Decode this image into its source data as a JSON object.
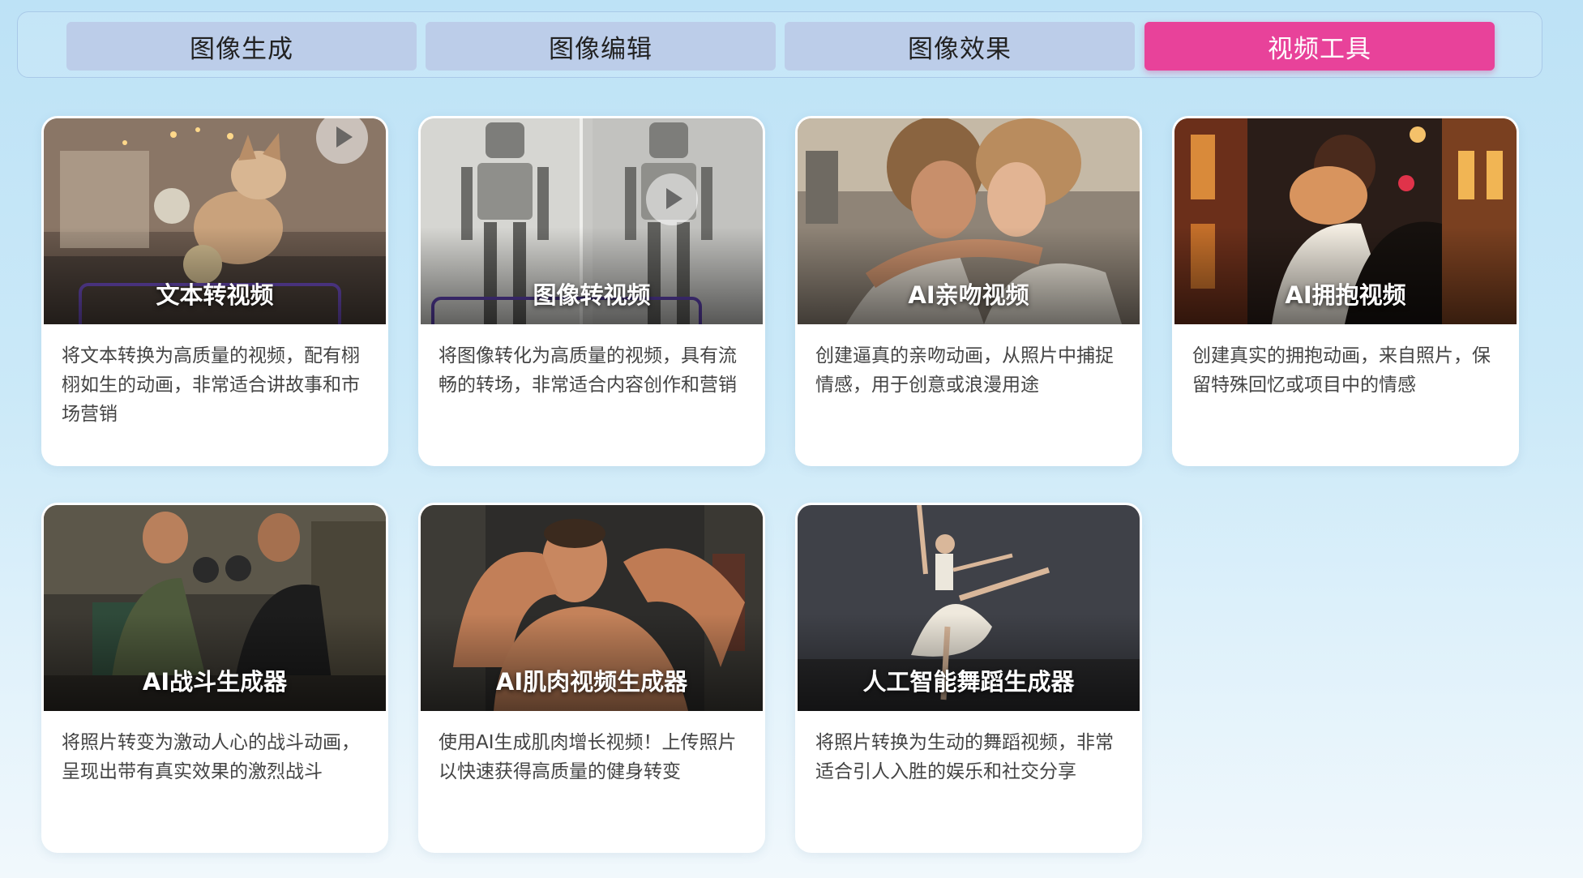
{
  "tabs": [
    {
      "label": "图像生成",
      "active": false
    },
    {
      "label": "图像编辑",
      "active": false
    },
    {
      "label": "图像效果",
      "active": false
    },
    {
      "label": "视频工具",
      "active": true
    }
  ],
  "colors": {
    "tab_active": "#e8429a",
    "tab_inactive": "#bccde9"
  },
  "cards": [
    {
      "title": "文本转视频",
      "description": "将文本转换为高质量的视频，配有栩栩如生的动画，非常适合讲故事和市场营销"
    },
    {
      "title": "图像转视频",
      "description": "将图像转化为高质量的视频，具有流畅的转场，非常适合内容创作和营销"
    },
    {
      "title": "AI亲吻视频",
      "description": "创建逼真的亲吻动画，从照片中捕捉情感，用于创意或浪漫用途"
    },
    {
      "title": "AI拥抱视频",
      "description": "创建真实的拥抱动画，来自照片，保留特殊回忆或项目中的情感"
    },
    {
      "title": "AI战斗生成器",
      "description": "将照片转变为激动人心的战斗动画，呈现出带有真实效果的激烈战斗"
    },
    {
      "title": "AI肌肉视频生成器",
      "description": "使用AI生成肌肉增长视频！上传照片以快速获得高质量的健身转变"
    },
    {
      "title": "人工智能舞蹈生成器",
      "description": "将照片转换为生动的舞蹈视频，非常适合引人入胜的娱乐和社交分享"
    }
  ]
}
